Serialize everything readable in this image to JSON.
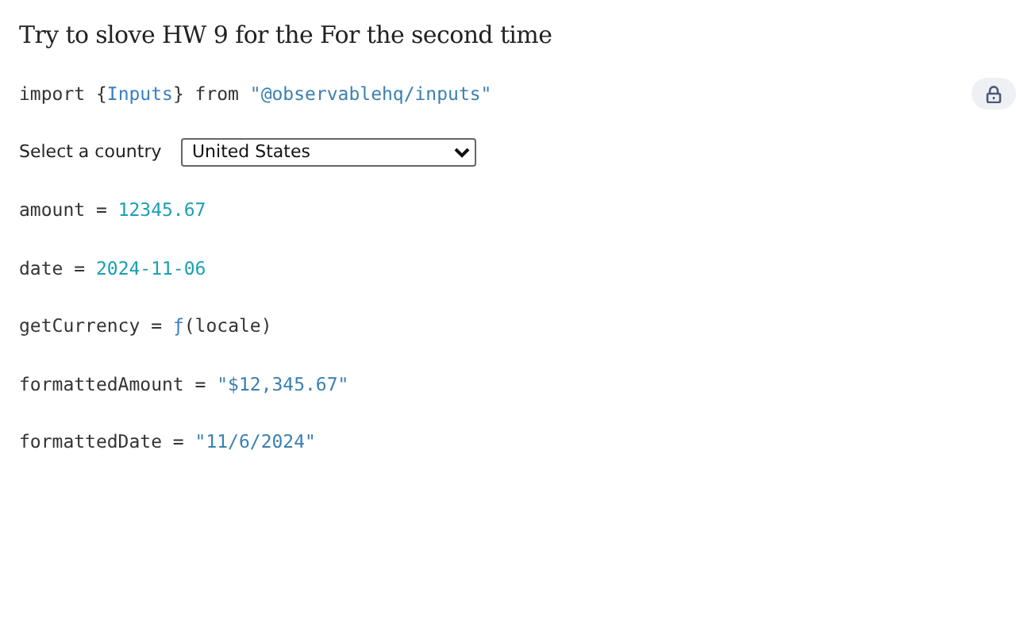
{
  "title": "Try to slove HW 9 for the For the second time",
  "cells": [
    {
      "kind": "code",
      "locked": true,
      "tokens": [
        {
          "kind": "text",
          "text": "import {"
        },
        {
          "kind": "name",
          "text": "Inputs"
        },
        {
          "kind": "text",
          "text": "} from "
        },
        {
          "kind": "string",
          "text": "\"@observablehq/inputs\""
        }
      ]
    },
    {
      "kind": "select",
      "label": "Select a country",
      "value": "United States"
    },
    {
      "kind": "code",
      "locked": false,
      "tokens": [
        {
          "kind": "text",
          "text": "amount = "
        },
        {
          "kind": "number",
          "text": "12345.67"
        }
      ]
    },
    {
      "kind": "code",
      "locked": false,
      "tokens": [
        {
          "kind": "text",
          "text": "date = "
        },
        {
          "kind": "number",
          "text": "2024-11-06"
        }
      ]
    },
    {
      "kind": "code",
      "locked": false,
      "tokens": [
        {
          "kind": "text",
          "text": "getCurrency = "
        },
        {
          "kind": "function",
          "text": "ƒ"
        },
        {
          "kind": "text",
          "text": "(locale)"
        }
      ]
    },
    {
      "kind": "code",
      "locked": false,
      "tokens": [
        {
          "kind": "text",
          "text": "formattedAmount = "
        },
        {
          "kind": "string",
          "text": "\"$12,345.67\""
        }
      ]
    },
    {
      "kind": "code",
      "locked": false,
      "tokens": [
        {
          "kind": "text",
          "text": "formattedDate = "
        },
        {
          "kind": "string",
          "text": "\"11/6/2024\""
        }
      ]
    }
  ]
}
